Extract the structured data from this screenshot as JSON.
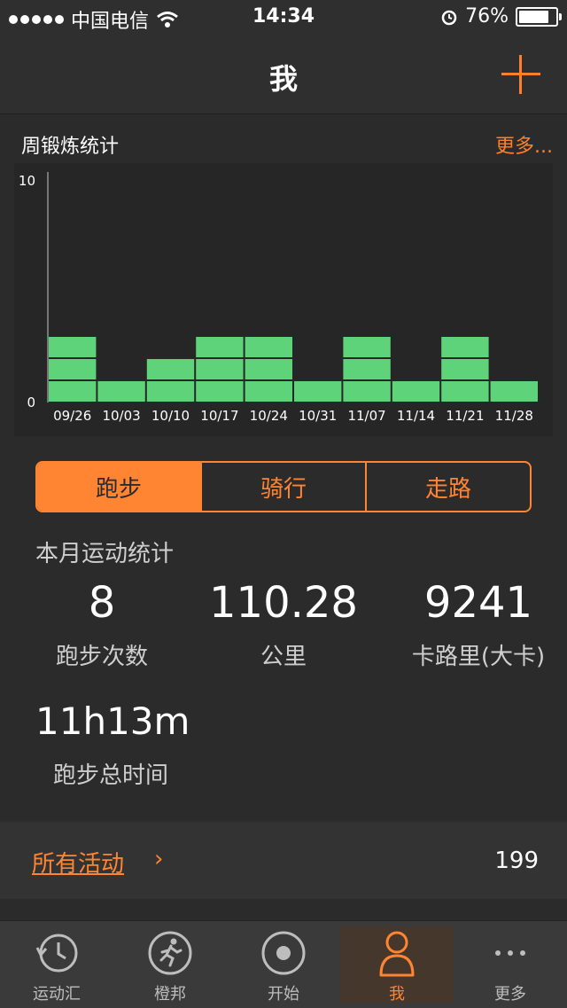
{
  "status_bar": {
    "carrier": "中国电信",
    "time": "14:34",
    "battery": "76%",
    "battery_level": 0.76
  },
  "nav": {
    "title": "我"
  },
  "weekly": {
    "title": "周锻炼统计",
    "more": "更多...",
    "chart_data": {
      "type": "bar",
      "title": "周锻炼统计",
      "categories": [
        "09/26",
        "10/03",
        "10/10",
        "10/17",
        "10/24",
        "10/31",
        "11/07",
        "11/14",
        "11/21",
        "11/28"
      ],
      "values": [
        3,
        1,
        2,
        3,
        3,
        1,
        3,
        1,
        3,
        1
      ],
      "ylim": [
        0,
        10
      ],
      "yticks": [
        "0",
        "10"
      ],
      "color": "#5fd37a"
    }
  },
  "segments": {
    "items": [
      "跑步",
      "骑行",
      "走路"
    ],
    "active": 0
  },
  "month": {
    "title": "本月运动统计",
    "runs_value": "8",
    "runs_label": "跑步次数",
    "km_value": "110.28",
    "km_label": "公里",
    "cal_value": "9241",
    "cal_label": "卡路里(大卡)",
    "time_value": "11h13m",
    "time_label": "跑步总时间"
  },
  "activities": {
    "label": "所有活动",
    "chevron": "›",
    "count": "199"
  },
  "tabs": [
    {
      "label": "运动汇",
      "icon": "history-clock-icon"
    },
    {
      "label": "橙邦",
      "icon": "runner-icon"
    },
    {
      "label": "开始",
      "icon": "record-icon"
    },
    {
      "label": "我",
      "icon": "person-icon"
    },
    {
      "label": "更多",
      "icon": "more-dots-icon"
    }
  ],
  "colors": {
    "accent": "#ff8533",
    "bar": "#5fd37a",
    "background": "#2b2b2b"
  }
}
